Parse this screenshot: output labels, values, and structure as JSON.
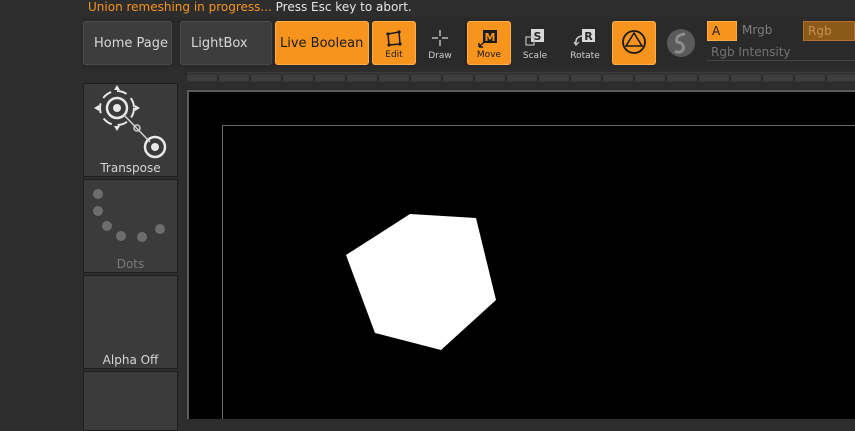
{
  "status": {
    "warning": "Union remeshing in progress...",
    "message": " Press Esc key to abort."
  },
  "toolbar": {
    "home_page": "Home Page",
    "lightbox": "LightBox",
    "live_boolean": "Live Boolean",
    "tools": {
      "edit": "Edit",
      "draw": "Draw",
      "move": "Move",
      "scale": "Scale",
      "rotate": "Rotate"
    },
    "a_label": "A",
    "mrgb": "Mrgb",
    "rgb": "Rgb",
    "rgb_intensity": "Rgb Intensity"
  },
  "left_panel": {
    "transpose": "Transpose",
    "dots": "Dots",
    "alpha_off": "Alpha Off"
  },
  "colors": {
    "accent": "#f7941d",
    "background": "#2d2d2d",
    "viewport": "#000000"
  }
}
